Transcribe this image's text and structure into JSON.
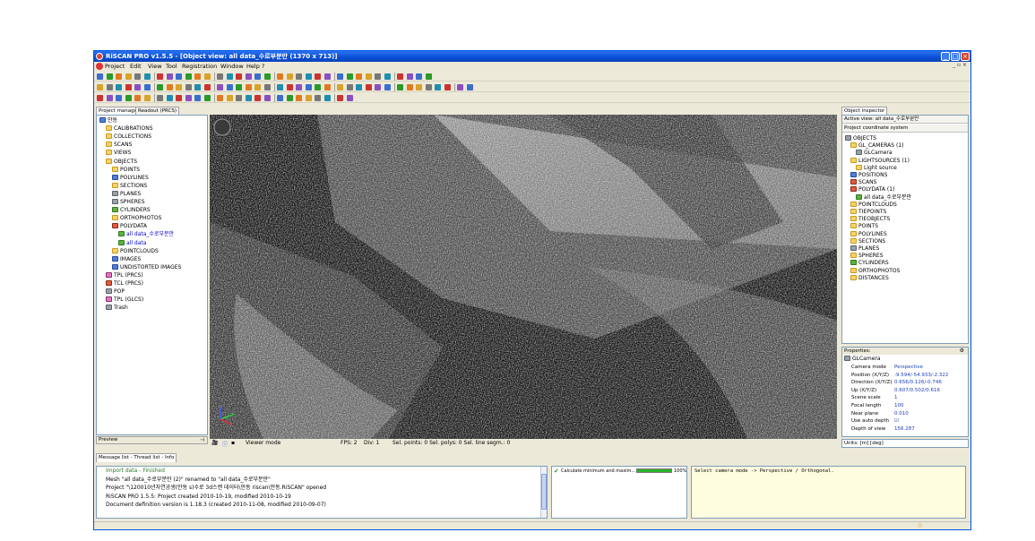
{
  "window": {
    "title": "RiSCAN PRO v1.5.5 - [Object view: all data_수로부분만 (1370 x 713)]"
  },
  "menubar": {
    "items": [
      "Project",
      "Edit",
      "View",
      "Tool",
      "Registration",
      "Window",
      "Help ?"
    ]
  },
  "left_panel": {
    "tabs": [
      "Project manager",
      "Readout (PRCS)"
    ],
    "tree": [
      {
        "label": "안동",
        "depth": 0,
        "icon": "project-icon"
      },
      {
        "label": "CALIBRATIONS",
        "depth": 1,
        "icon": "folder-icon"
      },
      {
        "label": "COLLECTIONS",
        "depth": 1,
        "icon": "folder-icon"
      },
      {
        "label": "SCANS",
        "depth": 1,
        "icon": "folder-icon"
      },
      {
        "label": "VIEWS",
        "depth": 1,
        "icon": "folder-icon"
      },
      {
        "label": "OBJECTS",
        "depth": 1,
        "icon": "folder-icon"
      },
      {
        "label": "POINTS",
        "depth": 2,
        "icon": "folder-icon"
      },
      {
        "label": "POLYLINES",
        "depth": 2,
        "icon": "polyline-icon"
      },
      {
        "label": "SECTIONS",
        "depth": 2,
        "icon": "folder-icon"
      },
      {
        "label": "PLANES",
        "depth": 2,
        "icon": "plane-icon"
      },
      {
        "label": "SPHERES",
        "depth": 2,
        "icon": "sphere-icon"
      },
      {
        "label": "CYLINDERS",
        "depth": 2,
        "icon": "cylinder-icon"
      },
      {
        "label": "ORTHOPHOTOS",
        "depth": 2,
        "icon": "folder-icon"
      },
      {
        "label": "POLYDATA",
        "depth": 2,
        "icon": "polydata-icon"
      },
      {
        "label": "all data_수로부분만",
        "depth": 3,
        "icon": "mesh-icon",
        "selected": true
      },
      {
        "label": "all data",
        "depth": 3,
        "icon": "mesh-icon",
        "selected": true
      },
      {
        "label": "POINTCLOUDS",
        "depth": 2,
        "icon": "folder-icon"
      },
      {
        "label": "IMAGES",
        "depth": 2,
        "icon": "image-icon"
      },
      {
        "label": "UNDISTORTED IMAGES",
        "depth": 2,
        "icon": "image-icon"
      },
      {
        "label": "TPL (PRCS)",
        "depth": 1,
        "icon": "tpl-icon"
      },
      {
        "label": "TCL (PRCS)",
        "depth": 1,
        "icon": "tcl-icon"
      },
      {
        "label": "POP",
        "depth": 1,
        "icon": "pop-icon"
      },
      {
        "label": "TPL (GLCS)",
        "depth": 1,
        "icon": "tpl-icon"
      },
      {
        "label": "Trash",
        "depth": 1,
        "icon": "trash-icon"
      }
    ],
    "preview_label": "Preview"
  },
  "viewport": {
    "status": {
      "mode": "Viewer mode",
      "fps": "FPS: 2",
      "div": "Div: 1",
      "selection": "Sel. points: 0  Sel. polys: 0  Sel. line segm.: 0"
    }
  },
  "right_panel": {
    "tab": "Object inspector",
    "active_view": "Active view:  all data_수로부분만",
    "coord_system": "Project coordinate system",
    "tree": [
      {
        "label": "OBJECTS",
        "depth": 0,
        "icon": "objects-icon"
      },
      {
        "label": "GL_CAMERAS (1)",
        "depth": 1,
        "icon": "folder-icon"
      },
      {
        "label": "GLCamera",
        "depth": 2,
        "icon": "camera-icon"
      },
      {
        "label": "LIGHTSOURCES (1)",
        "depth": 1,
        "icon": "folder-icon"
      },
      {
        "label": "Light source",
        "depth": 2,
        "icon": "light-icon"
      },
      {
        "label": "POSITIONS",
        "depth": 1,
        "icon": "position-icon"
      },
      {
        "label": "SCANS",
        "depth": 1,
        "icon": "scan-icon"
      },
      {
        "label": "POLYDATA (1)",
        "depth": 1,
        "icon": "polydata-icon"
      },
      {
        "label": "all data_수로부분만",
        "depth": 2,
        "icon": "mesh-icon"
      },
      {
        "label": "POINTCLOUDS",
        "depth": 1,
        "icon": "folder-icon"
      },
      {
        "label": "TIEPOINTS",
        "depth": 1,
        "icon": "folder-icon"
      },
      {
        "label": "TIEOBJECTS",
        "depth": 1,
        "icon": "folder-icon"
      },
      {
        "label": "POINTS",
        "depth": 1,
        "icon": "folder-icon"
      },
      {
        "label": "POLYLINES",
        "depth": 1,
        "icon": "folder-icon"
      },
      {
        "label": "SECTIONS",
        "depth": 1,
        "icon": "folder-icon"
      },
      {
        "label": "PLANES",
        "depth": 1,
        "icon": "plane-icon"
      },
      {
        "label": "SPHERES",
        "depth": 1,
        "icon": "folder-icon"
      },
      {
        "label": "CYLINDERS",
        "depth": 1,
        "icon": "cylinder-icon"
      },
      {
        "label": "ORTHOPHOTOS",
        "depth": 1,
        "icon": "folder-icon"
      },
      {
        "label": "DISTANCES",
        "depth": 1,
        "icon": "folder-icon"
      }
    ],
    "properties": {
      "header": "Properties:",
      "object": "GLCamera",
      "rows": [
        {
          "key": "Camera mode",
          "value": "Perspective"
        },
        {
          "key": "Position (X/Y/Z)",
          "value": "-9.594/-54.933/-2.322"
        },
        {
          "key": "Direction (X/Y/Z)",
          "value": "0.656/0.126/-0.746"
        },
        {
          "key": "Up (X/Y/Z)",
          "value": "0.607/0.502/0.616"
        },
        {
          "key": "Scene scale",
          "value": "1"
        },
        {
          "key": "Focal length",
          "value": "100"
        },
        {
          "key": "Near plane",
          "value": "0.010"
        },
        {
          "key": "Use auto depth",
          "value": "☑"
        },
        {
          "key": "Depth of view",
          "value": "156.287"
        }
      ]
    },
    "units": "Units:  [m]  [deg]"
  },
  "messages": {
    "tab": "Message list - Thread list - Info",
    "log": [
      "Import data - Finished",
      "Mesh \"all data_수로부분만 (2)\" renamed to \"all data_수로부분만\"",
      "Project \"\\120010년자연공생(안동 s)수로 3d스캔 데이터\\안동 riscan\\안동.RiSCAN\" opened",
      "RiSCAN PRO 1.5.5: Project created 2010-10-19, modified 2010-10-19",
      "Document definition version is 1.18.3 (created 2010-11-08, modified 2010-09-07)"
    ],
    "thread": {
      "label": "Calculate minimum and maxim...",
      "progress_pct": 100,
      "progress_text": "100%"
    },
    "console": "Select camera mode -> Perspective / Orthogonal."
  },
  "colors": {
    "titlebar": "#0a4fd6",
    "chrome": "#ece9d8",
    "link_blue": "#0000cc",
    "progress": "#2bb32b"
  }
}
